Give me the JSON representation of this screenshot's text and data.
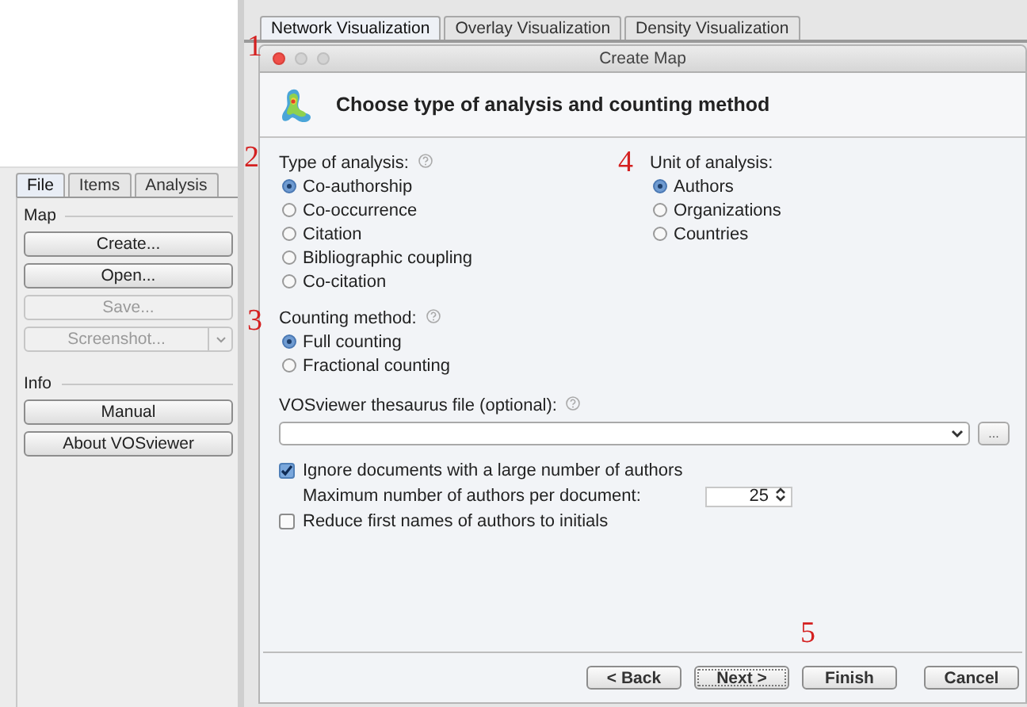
{
  "left_panel": {
    "tabs": [
      {
        "label": "File",
        "selected": true
      },
      {
        "label": "Items",
        "selected": false
      },
      {
        "label": "Analysis",
        "selected": false
      }
    ],
    "sections": [
      {
        "title": "Map",
        "buttons": [
          {
            "label": "Create...",
            "disabled": false,
            "kind": "plain"
          },
          {
            "label": "Open...",
            "disabled": false,
            "kind": "plain"
          },
          {
            "label": "Save...",
            "disabled": true,
            "kind": "plain"
          },
          {
            "label": "Screenshot...",
            "disabled": true,
            "kind": "split"
          }
        ]
      },
      {
        "title": "Info",
        "buttons": [
          {
            "label": "Manual",
            "disabled": false,
            "kind": "plain"
          },
          {
            "label": "About VOSviewer",
            "disabled": false,
            "kind": "plain"
          }
        ]
      }
    ]
  },
  "view_tabs": [
    {
      "label": "Network Visualization",
      "selected": true
    },
    {
      "label": "Overlay Visualization",
      "selected": false
    },
    {
      "label": "Density Visualization",
      "selected": false
    }
  ],
  "dialog": {
    "title": "Create Map",
    "heading": "Choose type of analysis and counting method",
    "type_of_analysis": {
      "label": "Type of analysis:",
      "options": [
        {
          "label": "Co-authorship",
          "selected": true
        },
        {
          "label": "Co-occurrence",
          "selected": false
        },
        {
          "label": "Citation",
          "selected": false
        },
        {
          "label": "Bibliographic coupling",
          "selected": false
        },
        {
          "label": "Co-citation",
          "selected": false
        }
      ]
    },
    "counting_method": {
      "label": "Counting method:",
      "options": [
        {
          "label": "Full counting",
          "selected": true
        },
        {
          "label": "Fractional counting",
          "selected": false
        }
      ]
    },
    "unit_of_analysis": {
      "label": "Unit of analysis:",
      "options": [
        {
          "label": "Authors",
          "selected": true
        },
        {
          "label": "Organizations",
          "selected": false
        },
        {
          "label": "Countries",
          "selected": false
        }
      ]
    },
    "thesaurus": {
      "label": "VOSviewer thesaurus file (optional):",
      "browse": "..."
    },
    "ignore_large": {
      "label": "Ignore documents with a large number of authors",
      "checked": true
    },
    "max_authors": {
      "label": "Maximum number of authors per document:",
      "value": "25"
    },
    "reduce_names": {
      "label": "Reduce first names of authors to initials",
      "checked": false
    },
    "buttons": [
      {
        "label": "< Back",
        "focused": false
      },
      {
        "label": "Next >",
        "focused": true
      },
      {
        "label": "Finish",
        "focused": false
      },
      {
        "label": "Cancel",
        "focused": false
      }
    ]
  },
  "annotations": [
    {
      "text": "1"
    },
    {
      "text": "2"
    },
    {
      "text": "3"
    },
    {
      "text": "4"
    },
    {
      "text": "5"
    }
  ]
}
